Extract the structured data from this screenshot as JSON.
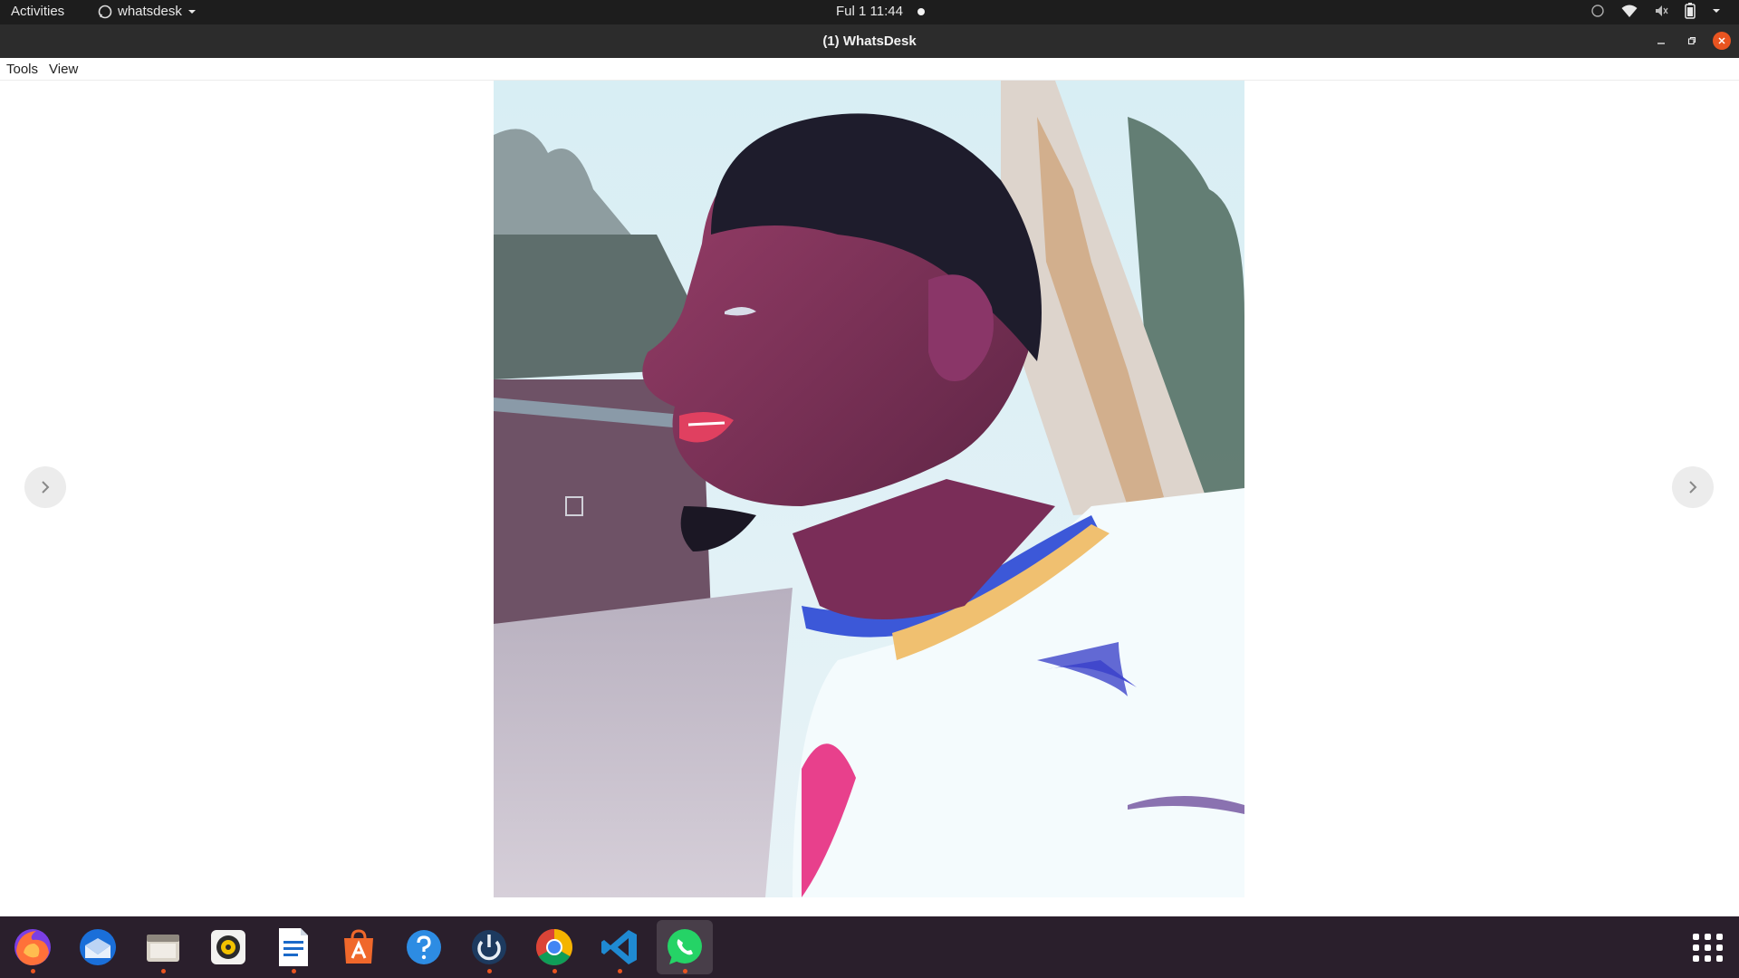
{
  "topbar": {
    "activities": "Activities",
    "app_name": "whatsdesk",
    "clock": "Ful 1  11:44",
    "tray_icons": [
      "whatsapp-tray-icon",
      "wifi-icon",
      "volume-muted-icon",
      "battery-icon",
      "system-menu-chevron-icon"
    ]
  },
  "window": {
    "title": "(1) WhatsDesk"
  },
  "menubar": {
    "tools": "Tools",
    "view": "View"
  },
  "viewer": {
    "image_description": "profile photo",
    "prev_icon": "chevron-right-icon",
    "next_icon": "chevron-right-icon"
  },
  "dock": {
    "apps": [
      {
        "name": "Firefox",
        "icon": "firefox-icon",
        "running": true
      },
      {
        "name": "Thunderbird",
        "icon": "thunderbird-icon",
        "running": false
      },
      {
        "name": "Files",
        "icon": "files-icon",
        "running": true
      },
      {
        "name": "Rhythmbox",
        "icon": "rhythmbox-icon",
        "running": false
      },
      {
        "name": "LibreOffice Writer",
        "icon": "writer-icon",
        "running": true
      },
      {
        "name": "Ubuntu Software",
        "icon": "software-icon",
        "running": false
      },
      {
        "name": "Help",
        "icon": "help-icon",
        "running": false
      },
      {
        "name": "Timeshift",
        "icon": "power-icon",
        "running": true
      },
      {
        "name": "Google Chrome",
        "icon": "chrome-icon",
        "running": true
      },
      {
        "name": "Visual Studio Code",
        "icon": "vscode-icon",
        "running": true
      },
      {
        "name": "WhatsDesk",
        "icon": "whatsapp-icon",
        "running": true
      }
    ],
    "show_apps_icon": "app-grid-icon"
  },
  "colors": {
    "accent": "#e95420",
    "topbar_bg": "#1d1d1d",
    "titlebar_bg": "#2c2c2c",
    "dock_bg": "#2a1f2c"
  }
}
